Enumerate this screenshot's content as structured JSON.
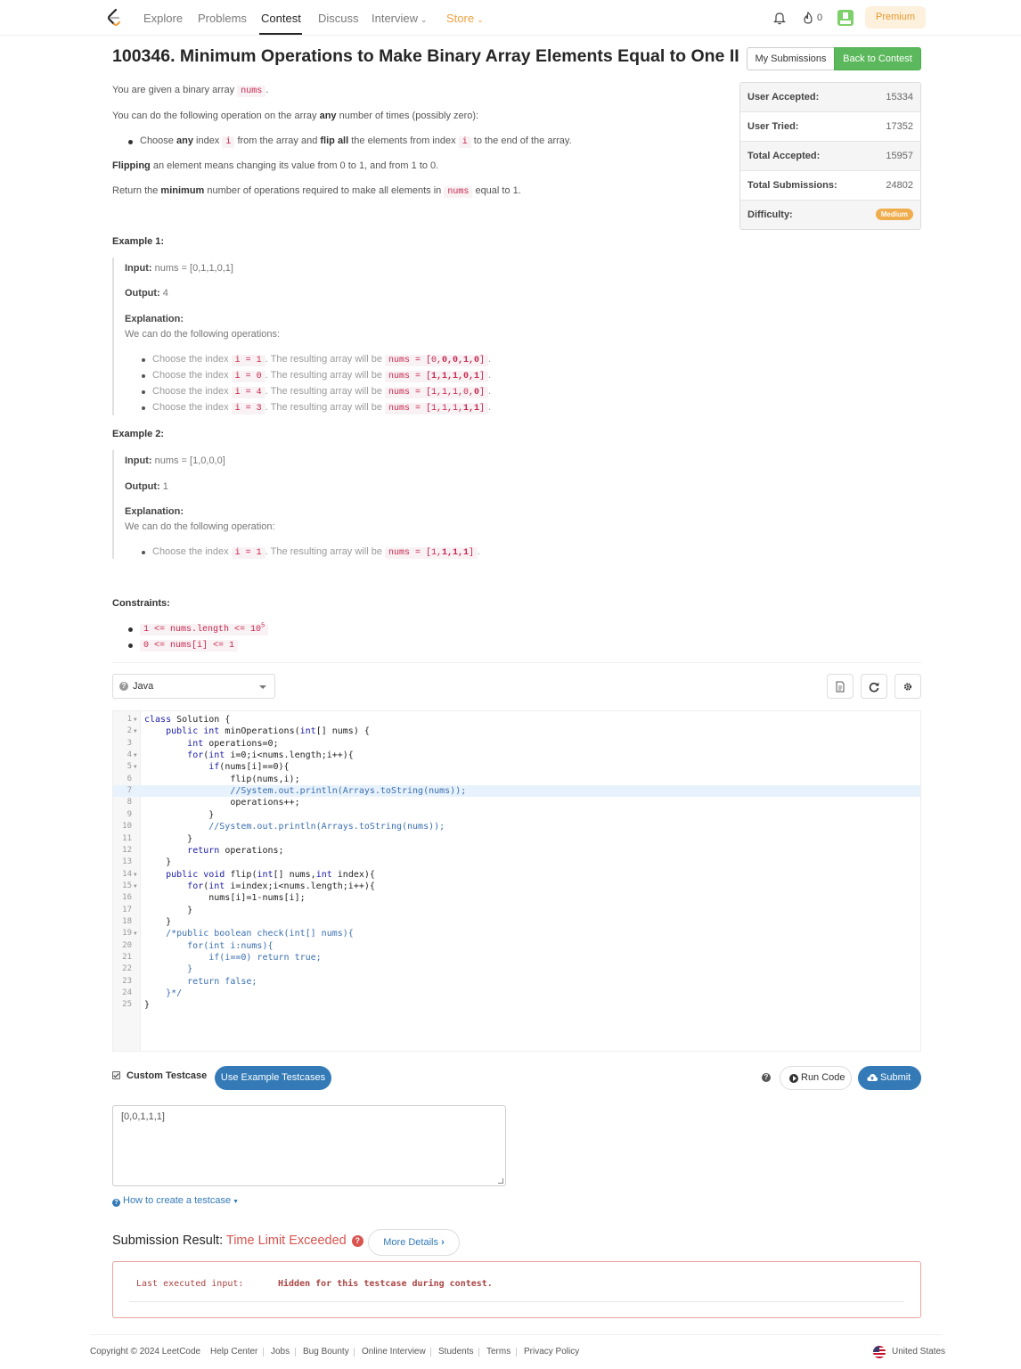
{
  "nav": {
    "items": [
      "Explore",
      "Problems",
      "Contest",
      "Discuss",
      "Interview",
      "Store"
    ],
    "streak": "0",
    "premium": "Premium"
  },
  "problem": {
    "title": "100346. Minimum Operations to Make Binary Array Elements Equal to One II",
    "my_submissions": "My Submissions",
    "back_to_contest": "Back to Contest"
  },
  "stats": [
    {
      "label": "User Accepted:",
      "value": "15334"
    },
    {
      "label": "User Tried:",
      "value": "17352"
    },
    {
      "label": "Total Accepted:",
      "value": "15957"
    },
    {
      "label": "Total Submissions:",
      "value": "24802"
    },
    {
      "label": "Difficulty:",
      "value": "Medium"
    }
  ],
  "desc": {
    "p1_a": "You are given a binary array ",
    "p1_code": "nums",
    "p1_b": ".",
    "p2_a": "You can do the following operation on the array ",
    "p2_bold": "any",
    "p2_b": " number of times (possibly zero):",
    "b1_a": "Choose ",
    "b1_bold1": "any",
    "b1_b": " index ",
    "b1_code1": "i",
    "b1_c": " from the array and ",
    "b1_bold2": "flip all",
    "b1_d": " the elements from index ",
    "b1_code2": "i",
    "b1_e": " to the end of the array.",
    "p3_bold": "Flipping",
    "p3_rest": " an element means changing its value from 0 to 1, and from 1 to 0.",
    "p4_a": "Return the ",
    "p4_bold": "minimum",
    "p4_b": " number of operations required to make all elements in ",
    "p4_code": "nums",
    "p4_c": " equal to 1."
  },
  "examples": {
    "ex1": {
      "title": "Example 1:",
      "input_label": "Input:",
      "input": " nums = [0,1,1,0,1]",
      "output_label": "Output:",
      "output": " 4",
      "expl_label": "Explanation:",
      "expl": "We can do the following operations:",
      "steps": [
        {
          "a": "Choose the index ",
          "idx": "i = 1",
          "b": ". The resulting array will be ",
          "pre": "nums = [0,",
          "arr": "0,0,1,0",
          "post": "]",
          "end": "."
        },
        {
          "a": "Choose the index ",
          "idx": "i = 0",
          "b": ". The resulting array will be ",
          "pre": "nums = [",
          "arr": "1,1,1,0,1",
          "post": "]",
          "end": "."
        },
        {
          "a": "Choose the index ",
          "idx": "i = 4",
          "b": ". The resulting array will be ",
          "pre": "nums = [1,1,1,0,",
          "arr": "0",
          "post": "]",
          "end": "."
        },
        {
          "a": "Choose the index ",
          "idx": "i = 3",
          "b": ". The resulting array will be ",
          "pre": "nums = [1,1,1,",
          "arr": "1,1",
          "post": "]",
          "end": "."
        }
      ]
    },
    "ex2": {
      "title": "Example 2:",
      "input_label": "Input:",
      "input": " nums = [1,0,0,0]",
      "output_label": "Output:",
      "output": " 1",
      "expl_label": "Explanation:",
      "expl": "We can do the following operation:",
      "steps": [
        {
          "a": "Choose the index ",
          "idx": "i = 1",
          "b": ". The resulting array will be ",
          "pre": "nums = [1,",
          "arr": "1,1,1",
          "post": "]",
          "end": "."
        }
      ]
    }
  },
  "constraints": {
    "title": "Constraints:",
    "c1": "1 <= nums.length <= 10",
    "c1_sup": "5",
    "c2": "0 <= nums[i] <= 1"
  },
  "editor": {
    "language": "Java",
    "lines": [
      "class Solution {",
      "    public int minOperations(int[] nums) {",
      "        int operations=0;",
      "        for(int i=0;i<nums.length;i++){",
      "            if(nums[i]==0){",
      "                flip(nums,i);",
      "                //System.out.println(Arrays.toString(nums));",
      "                operations++;",
      "            }",
      "            //System.out.println(Arrays.toString(nums));",
      "        }",
      "        return operations;",
      "    }",
      "    public void flip(int[] nums,int index){",
      "        for(int i=index;i<nums.length;i++){",
      "            nums[i]=1-nums[i];",
      "        }",
      "    }",
      "    /*public boolean check(int[] nums){",
      "        for(int i:nums){",
      "            if(i==0) return true;",
      "        }",
      "        return false;",
      "    }*/",
      "}"
    ]
  },
  "testcase": {
    "custom_label": "Custom Testcase",
    "use_example": "Use Example Testcases",
    "run": "Run Code",
    "submit": "Submit",
    "value": "[0,0,1,1,1]",
    "howto": "How to create a testcase"
  },
  "result": {
    "label": "Submission Result: ",
    "status": "Time Limit Exceeded",
    "more": "More Details",
    "key": "Last executed input:",
    "value": "Hidden for this testcase during contest."
  },
  "footer": {
    "copyright": "Copyright © 2024 LeetCode",
    "links": [
      "Help Center",
      "Jobs",
      "Bug Bounty",
      "Online Interview",
      "Students",
      "Terms",
      "Privacy Policy"
    ],
    "region": "United States"
  }
}
